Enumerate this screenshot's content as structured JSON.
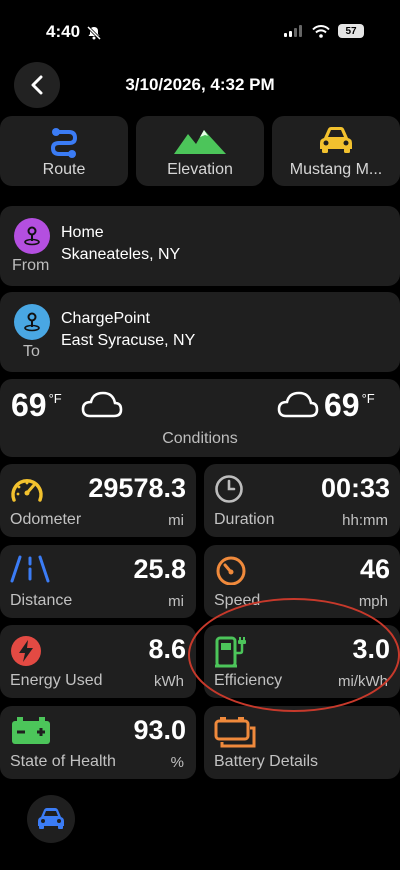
{
  "status_bar": {
    "time": "4:40",
    "battery": "57"
  },
  "header": {
    "title": "3/10/2026, 4:32 PM"
  },
  "tabs": [
    {
      "label": "Route",
      "icon": "route-icon"
    },
    {
      "label": "Elevation",
      "icon": "mountains-icon"
    },
    {
      "label": "Mustang M...",
      "icon": "car-icon"
    }
  ],
  "from": {
    "role": "From",
    "name": "Home",
    "address": "Skaneateles, NY",
    "color": "#b44fe0"
  },
  "to": {
    "role": "To",
    "name": "ChargePoint",
    "address": "East Syracuse, NY",
    "color": "#49a7e3"
  },
  "conditions": {
    "temp_start": "69",
    "temp_end": "69",
    "unit": "°F",
    "label": "Conditions"
  },
  "stats": {
    "odometer": {
      "label": "Odometer",
      "value": "29578.3",
      "unit": "mi",
      "color": "#f2c12e"
    },
    "duration": {
      "label": "Duration",
      "value": "00:33",
      "unit": "hh:mm",
      "color": "#bdbdbd"
    },
    "distance": {
      "label": "Distance",
      "value": "25.8",
      "unit": "mi",
      "color": "#3b7cf5"
    },
    "speed": {
      "label": "Speed",
      "value": "46",
      "unit": "mph",
      "color": "#f08a3c"
    },
    "energy_used": {
      "label": "Energy Used",
      "value": "8.6",
      "unit": "kWh",
      "color": "#e34a43"
    },
    "efficiency": {
      "label": "Efficiency",
      "value": "3.0",
      "unit": "mi/kWh",
      "color": "#4cc55a"
    },
    "state_of_health": {
      "label": "State of Health",
      "value": "93.0",
      "unit": "%",
      "color": "#4cc55a"
    },
    "battery_details": {
      "label": "Battery Details",
      "color": "#f08a3c"
    }
  },
  "bottom": {
    "icon": "car-icon",
    "color": "#3b7cf5"
  }
}
